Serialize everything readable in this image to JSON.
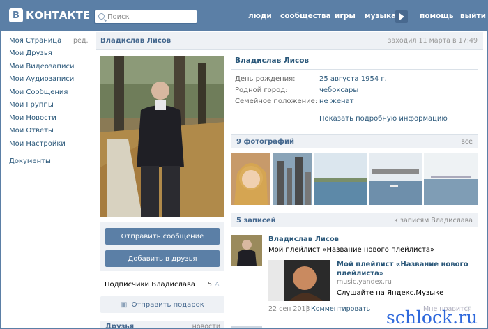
{
  "header": {
    "logo_text": "КОНТАКТЕ",
    "logo_badge": "В",
    "search_placeholder": "Поиск",
    "nav": [
      "люди",
      "сообщества",
      "игры",
      "музыка",
      "помощь",
      "выйти"
    ]
  },
  "sidebar": {
    "items": [
      "Моя Страница",
      "Мои Друзья",
      "Мои Видеозаписи",
      "Мои Аудиозаписи",
      "Мои Сообщения",
      "Мои Группы",
      "Мои Новости",
      "Мои Ответы",
      "Мои Настройки"
    ],
    "edit": "ред.",
    "documents": "Документы"
  },
  "profile": {
    "name": "Владислав Лисов",
    "last_seen": "заходил 11 марта в 17:49",
    "birthday_label": "День рождения:",
    "birthday": "25 августа 1954 г.",
    "city_label": "Родной город:",
    "city": "чебоксары",
    "status_label": "Семейное положение:",
    "status": "не женат",
    "more": "Показать подробную информацию"
  },
  "actions": {
    "message": "Отправить сообщение",
    "add_friend": "Добавить в друзья",
    "subscribers": "Подписчики Владислава",
    "subscribers_count": "5",
    "gift": "Отправить подарок",
    "friends": "Друзья",
    "news": "новости"
  },
  "photos": {
    "title": "9 фотографий",
    "all": "все"
  },
  "wall": {
    "title": "5 записей",
    "link": "к записям Владислава",
    "author": "Владислав Лисов",
    "text": "Мой плейлист «Название нового плейлиста»",
    "link_title": "Мой плейлист «Название нового плейлиста»",
    "link_url": "music.yandex.ru",
    "link_desc": "Слушайте на Яндекс.Музыке",
    "date": "22 сен 2013",
    "comment": "Комментировать",
    "like": "Мне нравится"
  },
  "watermark": "schlock.ru"
}
